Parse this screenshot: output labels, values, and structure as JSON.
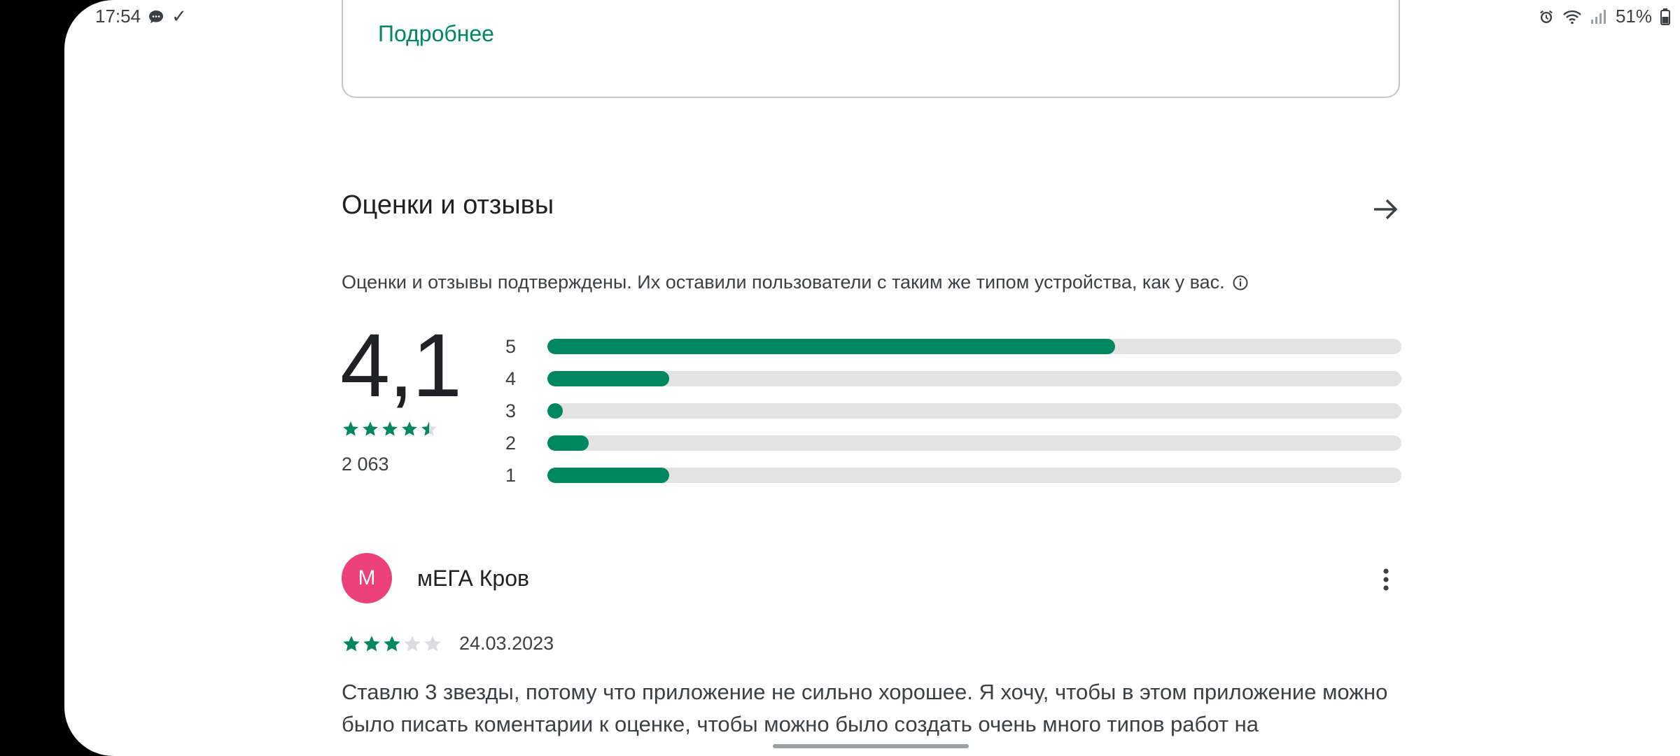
{
  "status_bar": {
    "time": "17:54",
    "check": "✓",
    "battery": "51%",
    "icons": [
      "chat-bubble-icon",
      "alarm-icon",
      "wifi-icon",
      "signal-icon",
      "battery-icon"
    ]
  },
  "details_card": {
    "link_label": "Подробнее"
  },
  "ratings_section": {
    "title": "Оценки и отзывы",
    "verify_text": "Оценки и отзывы подтверждены. Их оставили пользователи с таким же типом устройства, как у вас.",
    "average": "4,1",
    "average_stars": 4.5,
    "count": "2 063",
    "histogram": [
      {
        "label": "5",
        "fraction": 0.665
      },
      {
        "label": "4",
        "fraction": 0.143
      },
      {
        "label": "3",
        "fraction": 0.018
      },
      {
        "label": "2",
        "fraction": 0.048
      },
      {
        "label": "1",
        "fraction": 0.143
      }
    ]
  },
  "review": {
    "avatar_letter": "М",
    "author": "мЕГА Кров",
    "stars": 3,
    "date": "24.03.2023",
    "text": "Ставлю 3 звезды, потому что приложение не сильно хорошее. Я хочу, чтобы в этом приложение можно было писать коментарии к оценке, чтобы можно было создать очень много типов работ на"
  },
  "colors": {
    "accent": "#01875f",
    "track": "#e3e3e3",
    "avatar": "#ec407a",
    "star_empty": "#dadce0"
  }
}
